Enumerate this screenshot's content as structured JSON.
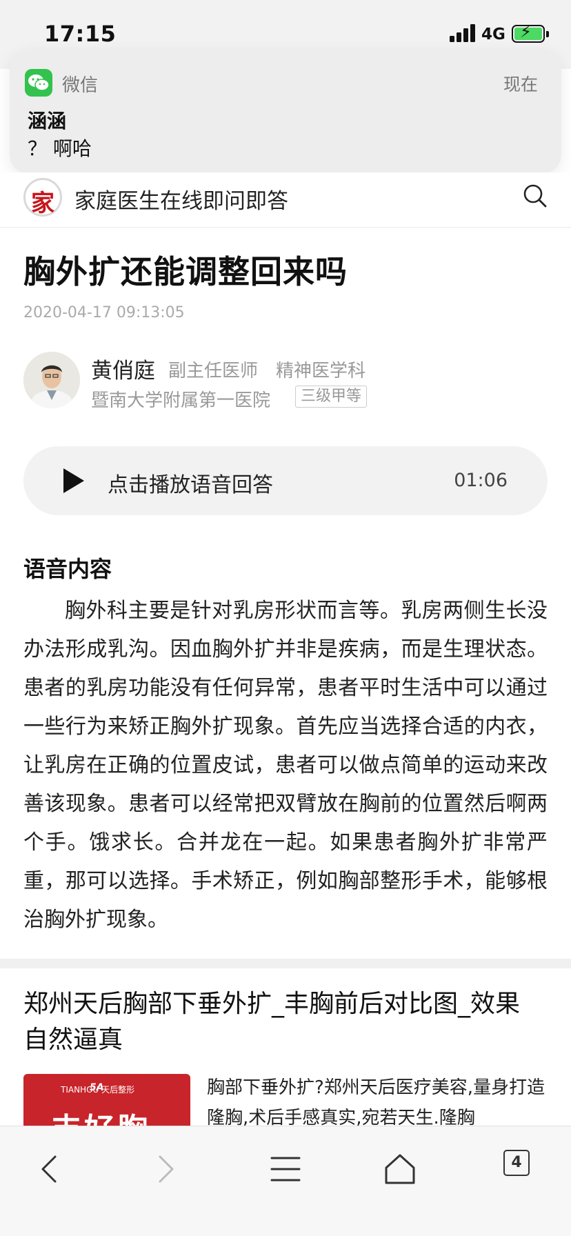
{
  "status_bar": {
    "time": "17:15",
    "network": "4G"
  },
  "notification": {
    "app_name": "微信",
    "time": "现在",
    "sender": "涵涵",
    "message": "？ 啊哈"
  },
  "site": {
    "logo_char": "家",
    "title": "家庭医生在线即问即答"
  },
  "article": {
    "title": "胸外扩还能调整回来吗",
    "date": "2020-04-17 09:13:05",
    "doctor": {
      "name": "黄俏庭",
      "title": "副主任医师",
      "department": "精神医学科",
      "hospital": "暨南大学附属第一医院",
      "hospital_grade": "三级甲等"
    },
    "audio": {
      "label": "点击播放语音回答",
      "duration": "01:06"
    },
    "section_heading": "语音内容",
    "body": "胸外科主要是针对乳房形状而言等。乳房两侧生长没办法形成乳沟。因血胸外扩并非是疾病，而是生理状态。患者的乳房功能没有任何异常，患者平时生活中可以通过一些行为来矫正胸外扩现象。首先应当选择合适的内衣，让乳房在正确的位置皮试，患者可以做点简单的运动来改善该现象。患者可以经常把双臂放在胸前的位置然后啊两个手。饿求长。合并龙在一起。如果患者胸外扩非常严重，那可以选择。手术矫正，例如胸部整形手术，能够根治胸外扩现象。"
  },
  "ad": {
    "title": "郑州天后胸部下垂外扩_丰胸前后对比图_效果自然逼真",
    "image_logo": "TIANHOU 天后整形",
    "image_badge": "5A",
    "image_text": "丰好胸",
    "description": "胸部下垂外扩?郑州天后医疗美容,量身打造隆胸,术后手感真实,宛若天生.隆胸"
  },
  "toolbar": {
    "tabs_count": "4"
  },
  "colors": {
    "wechat_green": "#32c24d",
    "logo_red": "#c8161d",
    "ad_red": "#c8242b",
    "battery_green": "#4cd964"
  }
}
